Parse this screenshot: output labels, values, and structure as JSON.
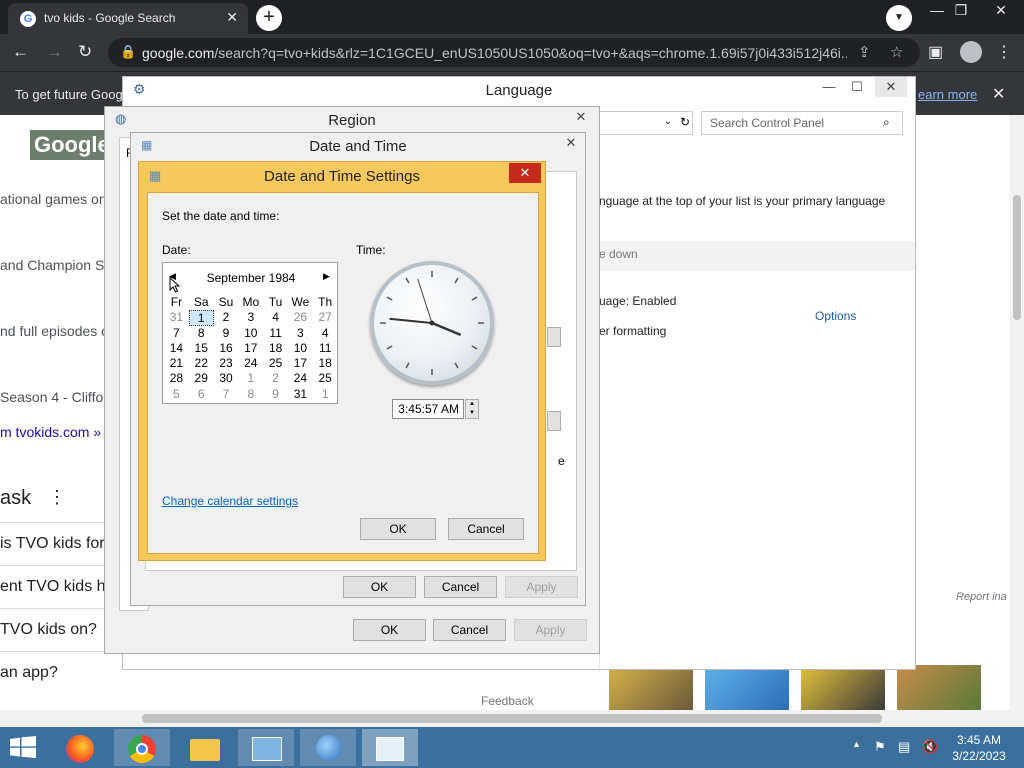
{
  "browser": {
    "tab_title": "tvo kids - Google Search",
    "favicon_letter": "G",
    "tab_close": "✕",
    "new_tab": "+",
    "url_host": "google.com",
    "url_rest": "/search?q=tvo+kids&rlz=1C1GCEU_enUS1050US1050&oq=tvo+&aqs=chrome.1.69i57j0i433i512j46i...",
    "infobar_message": "To get future Goog",
    "infobar_link": "earn more",
    "infobar_close": "✕"
  },
  "google_page": {
    "logo": "Google",
    "lines": [
      "ational games onli",
      "and Champion S5",
      "nd full episodes o",
      "Season 4 - Cliffor",
      "m tvokids.com »"
    ],
    "heading": "ask",
    "heading_menu": "⋮",
    "questions": [
      "is TVO kids for",
      "ent TVO kids h",
      "TVO kids on?",
      "an app?"
    ],
    "report": "Report ina",
    "feedback": "Feedback"
  },
  "language_window": {
    "title": "Language",
    "search_placeholder": "Search Control Panel",
    "text_primary": "nguage at the top of your list is your primary language",
    "text_move_down": "e down",
    "text_enabled": "uage: Enabled",
    "text_formatting": "er formatting",
    "options_link": "Options",
    "stray_e": "e"
  },
  "region_window": {
    "title": "Region",
    "tab_initial": "F",
    "ok": "OK",
    "cancel": "Cancel",
    "apply": "Apply"
  },
  "datetime_window": {
    "title": "Date and Time",
    "ok": "OK",
    "cancel": "Cancel",
    "apply": "Apply"
  },
  "dts_window": {
    "title": "Date and Time Settings",
    "instruction": "Set the date and time:",
    "date_label": "Date:",
    "time_label": "Time:",
    "calendar_month": "September 1984",
    "weekdays": [
      "Fr",
      "Sa",
      "Su",
      "Mo",
      "Tu",
      "We",
      "Th"
    ],
    "weeks": [
      [
        "31",
        "1",
        "2",
        "3",
        "4",
        "26",
        "27"
      ],
      [
        "7",
        "8",
        "9",
        "10",
        "11",
        "3",
        "4"
      ],
      [
        "14",
        "15",
        "16",
        "17",
        "18",
        "10",
        "11"
      ],
      [
        "21",
        "22",
        "23",
        "24",
        "25",
        "17",
        "18"
      ],
      [
        "28",
        "29",
        "30",
        "1",
        "2",
        "24",
        "25"
      ],
      [
        "5",
        "6",
        "7",
        "8",
        "9",
        "31",
        "1"
      ]
    ],
    "time_value": "3:45:57 AM",
    "clock": {
      "hours": 3,
      "minutes": 45,
      "seconds": 57
    },
    "change_calendar_link": "Change calendar settings",
    "ok": "OK",
    "cancel": "Cancel",
    "close": "✕"
  },
  "taskbar": {
    "time": "3:45 AM",
    "date": "3/22/2023"
  }
}
